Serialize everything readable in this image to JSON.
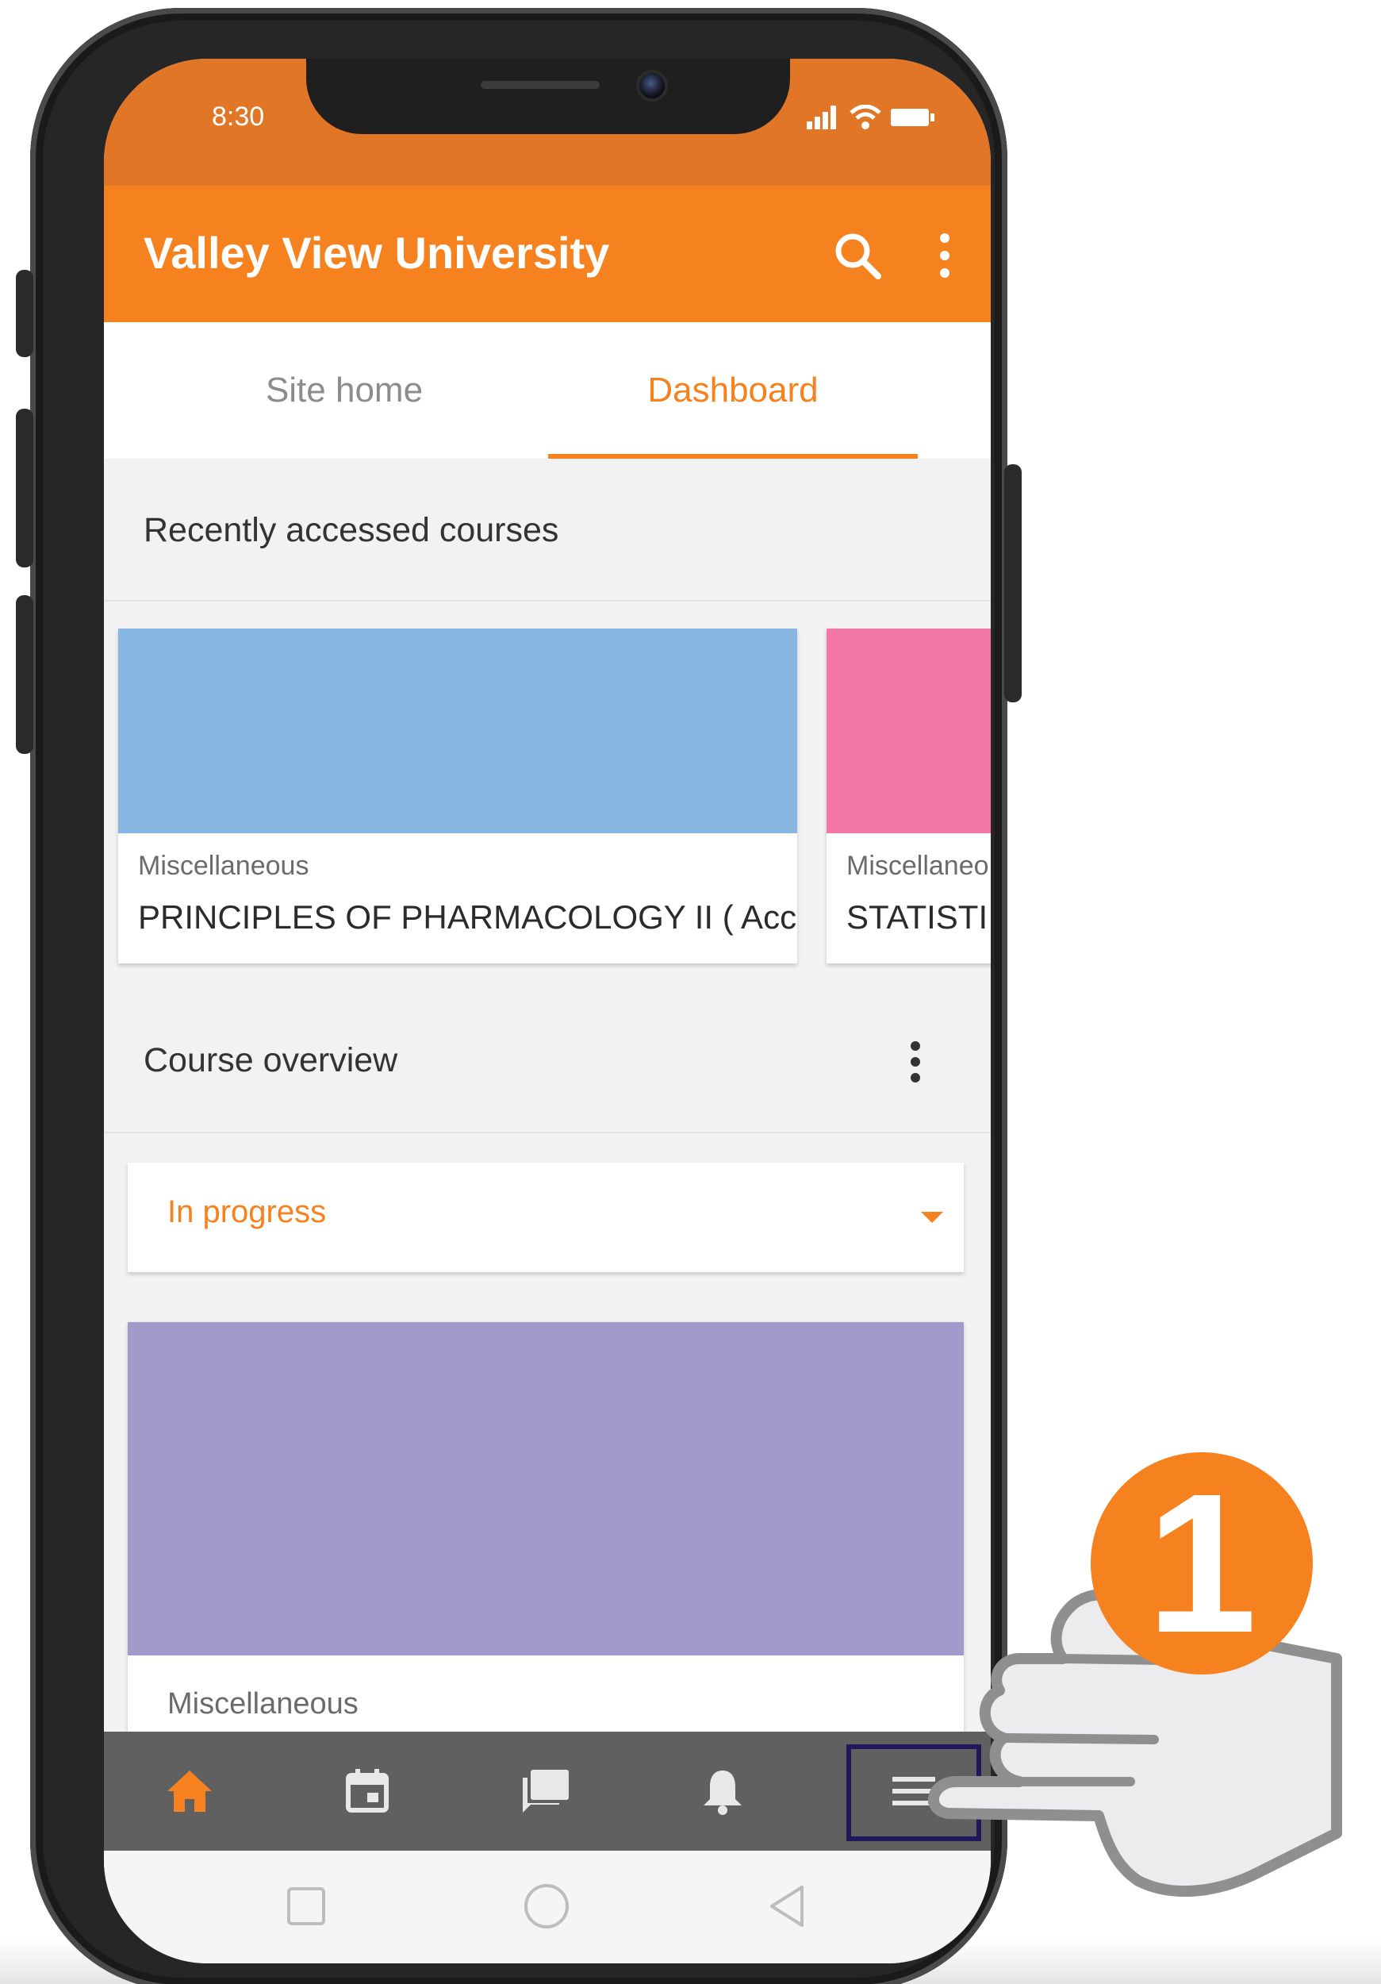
{
  "status_bar": {
    "time": "8:30"
  },
  "app_bar": {
    "title": "Valley View University"
  },
  "tabs": [
    {
      "label": "Site home",
      "active": false
    },
    {
      "label": "Dashboard",
      "active": true
    }
  ],
  "recent": {
    "title": "Recently accessed courses",
    "cards": [
      {
        "category": "Miscellaneous",
        "name": "PRINCIPLES OF PHARMACOLOGY II ( Acc...",
        "color": "#87b6e2"
      },
      {
        "category": "Miscellaneo",
        "name": "STATISTI",
        "color": "#f478a6"
      }
    ]
  },
  "overview": {
    "title": "Course overview",
    "filter": {
      "selected": "In progress"
    },
    "card": {
      "category": "Miscellaneous",
      "color": "#a29bca"
    }
  },
  "bottom_nav": {
    "items": [
      "home-icon",
      "calendar-icon",
      "messages-icon",
      "notifications-icon",
      "menu-icon"
    ],
    "active": "home-icon",
    "highlighted": "menu-icon"
  },
  "callout": {
    "step": "1"
  },
  "colors": {
    "brand_orange": "#f5821f",
    "status_orange": "#e27627",
    "nav_gray": "#606060"
  }
}
